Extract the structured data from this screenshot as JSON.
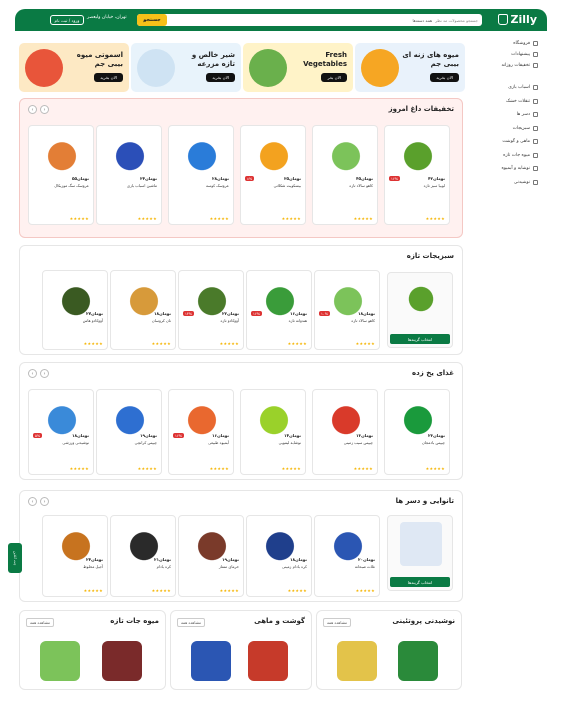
{
  "header": {
    "logo": "Zilly",
    "search_placeholder": "جستجو محصولات مد نظر",
    "search_category": "همه دسته‌ها",
    "search_button": "جستجو",
    "location": "تهران، خیابان ولیعصر",
    "login": "ورود / ثبت نام"
  },
  "sidebar": {
    "top": [
      {
        "label": "فروشگاه",
        "icon": "store-icon"
      },
      {
        "label": "پیشنهادات",
        "icon": "tag-icon"
      },
      {
        "label": "تخفیفات روزانه",
        "icon": "percent-icon"
      }
    ],
    "cats": [
      {
        "label": "اسباب بازی",
        "icon": "toy-icon"
      },
      {
        "label": "تنقلات خشک",
        "icon": "snack-icon"
      },
      {
        "label": "دسر ها",
        "icon": "dessert-icon"
      },
      {
        "label": "سبزیجات",
        "icon": "vegetable-icon"
      },
      {
        "label": "ماهی و گوشت",
        "icon": "fish-icon"
      },
      {
        "label": "میوه جات تازه",
        "icon": "fruit-icon"
      },
      {
        "label": "نوشابه و آبمیوه",
        "icon": "juice-icon"
      },
      {
        "label": "نوشیدنی",
        "icon": "drink-icon"
      }
    ]
  },
  "promos": [
    {
      "title": "میوه های زنه ای بیبی جم",
      "btn": "الان بخرید",
      "color": "#e9f2fb"
    },
    {
      "title": "Fresh Vegetables",
      "btn": "الان بخر",
      "color": "#fff3c8"
    },
    {
      "title": "شیر خالص و تازه مزرعه",
      "btn": "الان بخرید",
      "color": "#e8f3fb"
    },
    {
      "title": "اسموتی میوه بیبی جم",
      "btn": "الان بخرید",
      "color": "#fde9c4"
    }
  ],
  "deals": {
    "title": "تخفیفات داغ امروز",
    "items": [
      {
        "name": "لوبیا سبز تازه",
        "price": "۴۲تومان",
        "old": "۵۰تومان",
        "off": "۱۶%",
        "color": "#5aa02c"
      },
      {
        "name": "کاهو سالاد تازه",
        "price": "۴۵تومان",
        "old": "",
        "off": "",
        "color": "#7cc35a"
      },
      {
        "name": "بیسکویت شکلاتی",
        "price": "۳۵تومان",
        "old": "۳۸تومان",
        "off": "۸%",
        "color": "#f3a21f"
      },
      {
        "name": "عروسک کوسه",
        "price": "۲۸تومان",
        "old": "",
        "off": "",
        "color": "#2a7cd9"
      },
      {
        "name": "ماشین اسباب بازی",
        "price": "۳۴تومان",
        "old": "",
        "off": "",
        "color": "#2b4fb8"
      },
      {
        "name": "عروسک سگ موزیکال",
        "price": "۵۵تومان",
        "old": "",
        "off": "",
        "color": "#e37e36"
      }
    ]
  },
  "veg": {
    "title": "سبزیجات تازه",
    "featured_btn": "انتخاب گزینه‌ها",
    "items": [
      {
        "name": "کاهو سالاد تازه",
        "price": "۱۸تومان",
        "off": "۱۰%",
        "color": "#7cc35a"
      },
      {
        "name": "هندوانه تازه",
        "price": "۱۶تومان",
        "off": "۱۶%",
        "color": "#3a9c3a"
      },
      {
        "name": "آووکادو تازه",
        "price": "۲۲تومان",
        "off": "۱۳%",
        "color": "#4a7a2a"
      },
      {
        "name": "نان کروسان",
        "price": "۱۸تومان",
        "off": "",
        "color": "#d79a3a"
      },
      {
        "name": "آووکادو هاس",
        "price": "۲۷تومان",
        "off": "",
        "color": "#3a5a22"
      }
    ]
  },
  "frozen": {
    "title": "غذای یخ زده",
    "items": [
      {
        "name": "چیپس بادمجان",
        "price": "۲۳تومان",
        "off": "",
        "color": "#1a9a3c"
      },
      {
        "name": "چیپس سیب زمینی",
        "price": "۱۳تومان",
        "off": "",
        "color": "#d93a2a"
      },
      {
        "name": "نوشابه لیمویی",
        "price": "۱۴تومان",
        "off": "",
        "color": "#9ad12a"
      },
      {
        "name": "آبمیوه طبیعی",
        "price": "۱۶تومان",
        "off": "۱۶%",
        "color": "#e9682f"
      },
      {
        "name": "چیپس کرانچی",
        "price": "۱۹تومان",
        "off": "",
        "color": "#2e6fd1"
      },
      {
        "name": "نوشیدنی ورزشی",
        "price": "۱۸تومان",
        "off": "۵%",
        "color": "#3a8ad9"
      }
    ]
  },
  "nuts": {
    "title": "تانوایی و دسر ها",
    "featured_btn": "انتخاب گزینه‌ها",
    "items": [
      {
        "name": "غلات صبحانه",
        "price": "۲۰تومان",
        "off": "",
        "color": "#2b56b3"
      },
      {
        "name": "کره بادام زمینی",
        "price": "۱۸تومان",
        "off": "",
        "color": "#1f3f8c"
      },
      {
        "name": "خرمای ممتاز",
        "price": "۱۹تومان",
        "off": "",
        "color": "#7a3a2a"
      },
      {
        "name": "کره بادام",
        "price": "۲۱تومان",
        "off": "",
        "color": "#2a2a2a"
      },
      {
        "name": "آجیل مخلوط",
        "price": "۲۴تومان",
        "off": "",
        "color": "#c7731f"
      }
    ]
  },
  "bottom": [
    {
      "title": "نوشیدنی پروتئینی",
      "link": "مشاهده همه"
    },
    {
      "title": "گوشت و ماهی",
      "link": "مشاهده همه"
    },
    {
      "title": "میوه جات تازه",
      "link": "مشاهده همه"
    }
  ],
  "chat_label": "چت آنلاین"
}
